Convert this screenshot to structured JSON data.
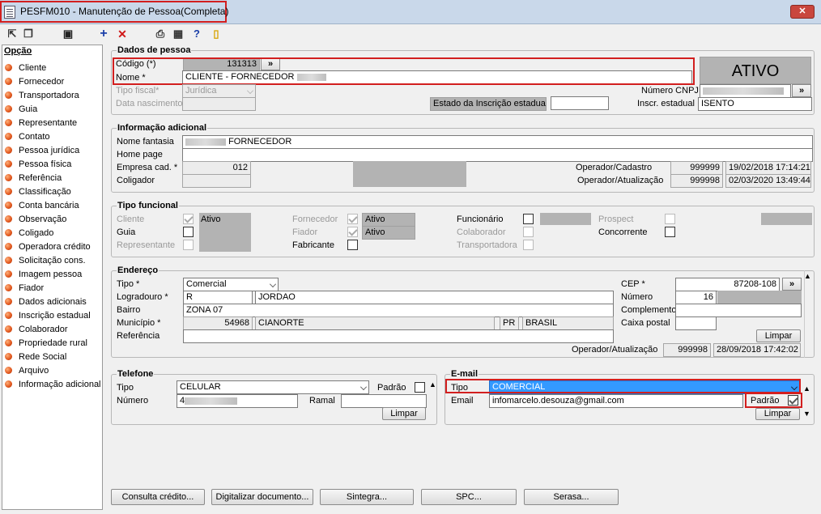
{
  "window": {
    "title": "PESFM010 - Manutenção de Pessoa(Completa)",
    "close_label": "✕"
  },
  "toolbar": {
    "icons": [
      "exit-icon",
      "copy-icon",
      "save-icon",
      "add-icon",
      "delete-icon",
      "print-icon",
      "calendar-icon",
      "help-icon",
      "door-icon"
    ]
  },
  "sidebar": {
    "header": "Opção",
    "items": [
      "Cliente",
      "Fornecedor",
      "Transportadora",
      "Guia",
      "Representante",
      "Contato",
      "Pessoa jurídica",
      "Pessoa física",
      "Referência",
      "Classificação",
      "Conta bancária",
      "Observação",
      "Coligado",
      "Operadora crédito",
      "Solicitação cons.",
      "Imagem pessoa",
      "Fiador",
      "Dados adicionais",
      "Inscrição estadual",
      "Colaborador",
      "Propriedade rural",
      "Rede Social",
      "Arquivo",
      "Informação adicional"
    ]
  },
  "dados": {
    "title": "Dados de pessoa",
    "codigo_label": "Código (*)",
    "codigo_value": "131313",
    "nome_label": "Nome *",
    "nome_value": "CLIENTE - FORNECEDOR",
    "tipo_fiscal_label": "Tipo fiscal*",
    "tipo_fiscal_value": "Jurídica",
    "data_nasc_label": "Data nascimento",
    "estado_insc_label": "Estado da Inscrição estadual",
    "status": "ATIVO",
    "cnpj_label": "Número CNPJ",
    "insc_label": "Inscr. estadual",
    "insc_value": "ISENTO",
    "more": "»"
  },
  "info": {
    "title": "Informação adicional",
    "fantasia_label": "Nome fantasia",
    "fantasia_value": "FORNECEDOR",
    "homepage_label": "Home page",
    "empresa_label": "Empresa cad. *",
    "empresa_value": "012",
    "coligador_label": "Coligador",
    "op_cad_label": "Operador/Cadastro",
    "op_cad_value": "999999",
    "op_cad_date": "19/02/2018 17:14:21",
    "op_at_label": "Operador/Atualização",
    "op_at_value": "999998",
    "op_at_date": "02/03/2020 13:49:44"
  },
  "funcional": {
    "title": "Tipo funcional",
    "cliente": "Cliente",
    "guia": "Guia",
    "representante": "Representante",
    "ativo": "Ativo",
    "fornecedor": "Fornecedor",
    "fiador": "Fiador",
    "fabricante": "Fabricante",
    "funcionario": "Funcionário",
    "colaborador": "Colaborador",
    "transportadora": "Transportadora",
    "prospect": "Prospect",
    "concorrente": "Concorrente"
  },
  "endereco": {
    "title": "Endereço",
    "tipo_label": "Tipo *",
    "tipo_value": "Comercial",
    "log_label": "Logradouro *",
    "log_tipo": "R",
    "log_value": "JORDAO",
    "bairro_label": "Bairro",
    "bairro_value": "ZONA 07",
    "mun_label": "Município *",
    "mun_code": "54968",
    "mun_value": "CIANORTE",
    "uf": "PR",
    "pais": "BRASIL",
    "ref_label": "Referência",
    "cep_label": "CEP *",
    "cep_value": "87208-108",
    "num_label": "Número",
    "num_value": "16",
    "comp_label": "Complemento",
    "caixa_label": "Caixa postal",
    "limpar": "Limpar",
    "op_label": "Operador/Atualização",
    "op_value": "999998",
    "op_date": "28/09/2018 17:42:02"
  },
  "telefone": {
    "title": "Telefone",
    "tipo_label": "Tipo",
    "tipo_value": "CELULAR",
    "padrao_label": "Padrão",
    "num_label": "Número",
    "num_value": "4",
    "ramal_label": "Ramal",
    "limpar": "Limpar"
  },
  "email": {
    "title": "E-mail",
    "tipo_label": "Tipo",
    "tipo_value": "COMERCIAL",
    "email_label": "Email",
    "email_value": "infomarcelo.desouza@gmail.com",
    "padrao_label": "Padrão",
    "limpar": "Limpar"
  },
  "buttons": {
    "consulta": "Consulta crédito...",
    "digitalizar": "Digitalizar documento...",
    "sintegra": "Sintegra...",
    "spc": "SPC...",
    "serasa": "Serasa..."
  }
}
